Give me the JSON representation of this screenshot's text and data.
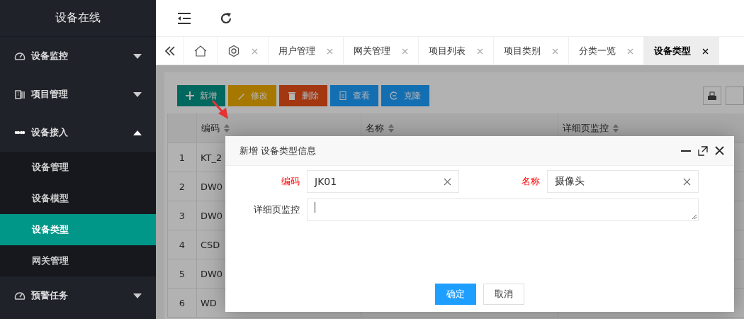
{
  "sidebar": {
    "title": "设备在线",
    "items": [
      {
        "label": "设备监控",
        "kind": "gauge",
        "expanded": false
      },
      {
        "label": "项目管理",
        "kind": "building",
        "expanded": false
      },
      {
        "label": "设备接入",
        "kind": "link",
        "expanded": true,
        "children": [
          {
            "label": "设备管理",
            "selected": false
          },
          {
            "label": "设备模型",
            "selected": false
          },
          {
            "label": "设备类型",
            "selected": true
          },
          {
            "label": "网关管理",
            "selected": false
          }
        ]
      },
      {
        "label": "预警任务",
        "kind": "gauge",
        "expanded": false
      }
    ]
  },
  "tabs": [
    {
      "kind": "home",
      "closable": false,
      "selected": false
    },
    {
      "kind": "settings",
      "closable": true,
      "selected": false
    },
    {
      "kind": "text",
      "label": "用户管理",
      "closable": true,
      "selected": false
    },
    {
      "kind": "text",
      "label": "网关管理",
      "closable": true,
      "selected": false
    },
    {
      "kind": "text",
      "label": "项目列表",
      "closable": true,
      "selected": false
    },
    {
      "kind": "text",
      "label": "项目类别",
      "closable": true,
      "selected": false
    },
    {
      "kind": "text",
      "label": "分类一览",
      "closable": true,
      "selected": false
    },
    {
      "kind": "text",
      "label": "设备类型",
      "closable": true,
      "selected": true
    }
  ],
  "toolbar": [
    {
      "kind": "add",
      "label": "新增"
    },
    {
      "kind": "edit",
      "label": "修改"
    },
    {
      "kind": "delete",
      "label": "删除"
    },
    {
      "kind": "view",
      "label": "查看"
    },
    {
      "kind": "clone",
      "label": "克隆"
    }
  ],
  "table": {
    "columns": [
      "编码",
      "名称",
      "详细页监控"
    ],
    "rows": [
      {
        "number": "1",
        "code": "KT_2"
      },
      {
        "number": "2",
        "code": "DW0"
      },
      {
        "number": "3",
        "code": "DW0"
      },
      {
        "number": "4",
        "code": "CSD"
      },
      {
        "number": "5",
        "code": "DW0"
      },
      {
        "number": "6",
        "code": "WD"
      }
    ]
  },
  "dialog": {
    "title": "新增 设备类型信息",
    "fields": [
      {
        "kind": "text",
        "label": "编码",
        "required": true,
        "value": "JK01"
      },
      {
        "kind": "text",
        "label": "名称",
        "required": true,
        "value": "摄像头"
      },
      {
        "kind": "textarea",
        "label": "详细页监控",
        "required": false
      }
    ],
    "buttons": [
      {
        "label": "确定",
        "primary": true
      },
      {
        "label": "取消",
        "primary": false
      }
    ]
  }
}
